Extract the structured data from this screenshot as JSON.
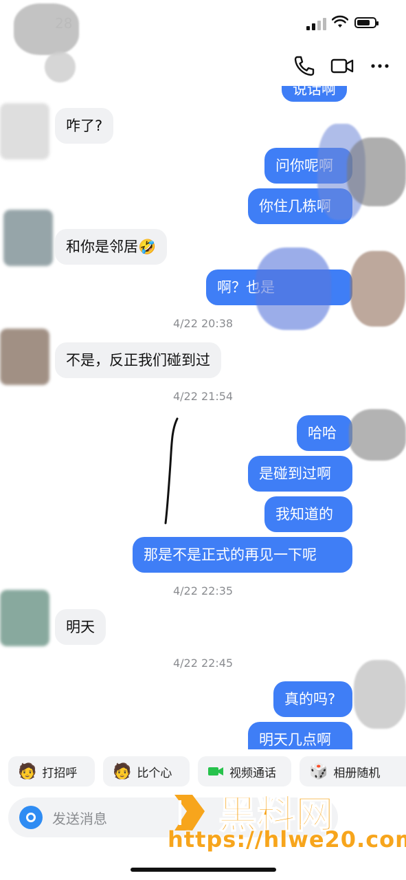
{
  "status": {
    "time": "28"
  },
  "header": {
    "call_icon": "phone-icon",
    "video_icon": "video-icon",
    "more_icon": "more-icon"
  },
  "messages": {
    "m0_partial": "说话啊",
    "m1": "咋了?",
    "m2": "问你呢啊",
    "m3": "你住几栋啊",
    "m4": "和你是邻居🤣",
    "m5": "啊？也是",
    "t1": "4/22 20:38",
    "m6": "不是，反正我们碰到过",
    "t2": "4/22 21:54",
    "m7": "哈哈",
    "m8": "是碰到过啊",
    "m9": "我知道的",
    "m10": "那是不是正式的再见一下呢",
    "t3": "4/22 22:35",
    "m11": "明天",
    "t4": "4/22 22:45",
    "m12": "真的吗?",
    "m13": "明天几点啊"
  },
  "quick_actions": [
    {
      "label": "打招呼",
      "icon": "avatar-sticker-icon"
    },
    {
      "label": "比个心",
      "icon": "avatar-sticker-icon"
    },
    {
      "label": "视频通话",
      "icon": "video-call-icon"
    },
    {
      "label": "相册随机",
      "icon": "dice-icon"
    }
  ],
  "composer": {
    "placeholder": "发送消息"
  },
  "watermark": {
    "brand": "黑料网",
    "url": "https://hlwe20.com"
  },
  "colors": {
    "outgoing": "#3f7ef6",
    "incoming": "#f0f1f3",
    "accent": "#2f8cf3",
    "watermark": "#f7a51c"
  }
}
